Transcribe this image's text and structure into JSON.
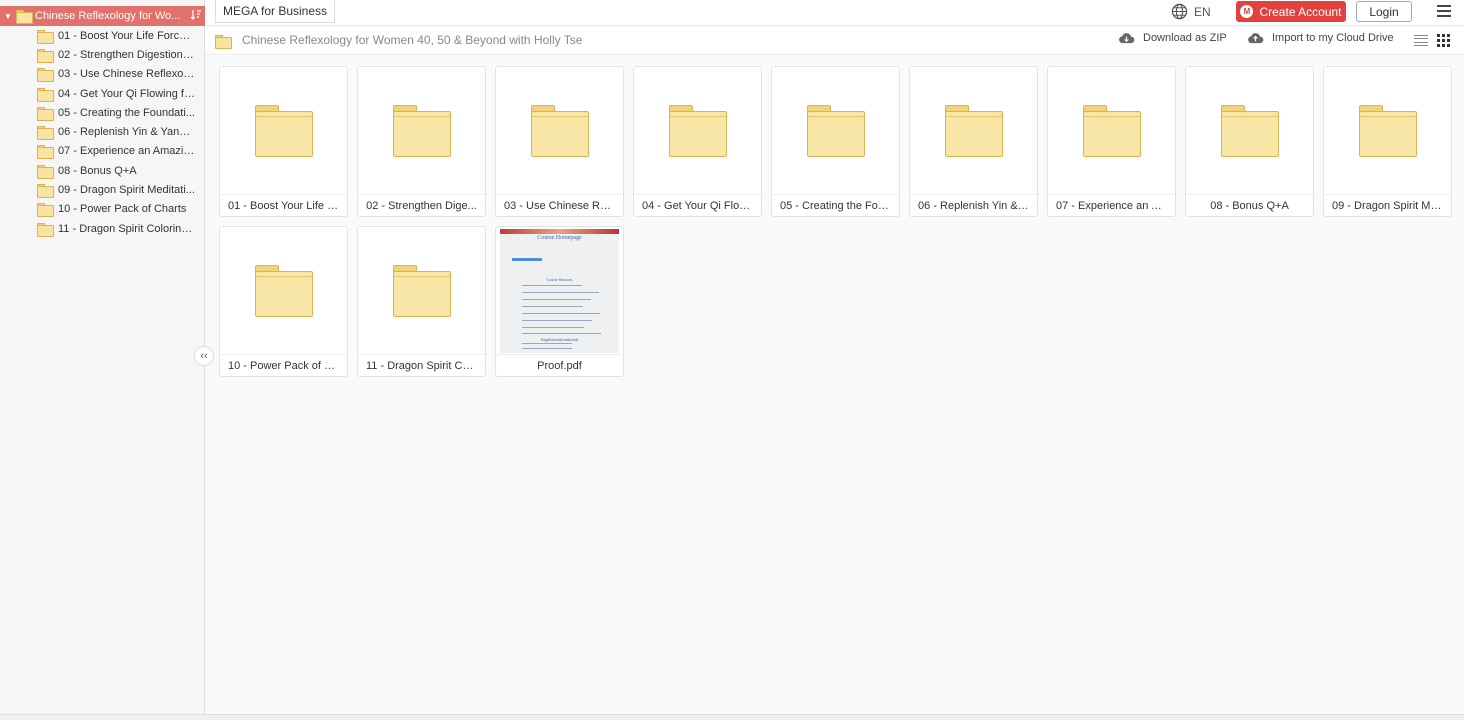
{
  "sidebar": {
    "root": {
      "label": "Chinese Reflexology for Wo...",
      "icon": "folder-icon"
    },
    "items": [
      {
        "label": "01 - Boost Your Life Force f..."
      },
      {
        "label": "02 - Strengthen Digestion f..."
      },
      {
        "label": "03 - Use Chinese Reflexolo..."
      },
      {
        "label": "04 - Get Your Qi Flowing fo..."
      },
      {
        "label": "05 - Creating the Foundati..."
      },
      {
        "label": "06 - Replenish Yin & Yang E..."
      },
      {
        "label": "07 - Experience an Amazin..."
      },
      {
        "label": "08 - Bonus Q+A"
      },
      {
        "label": "09 - Dragon Spirit Meditati..."
      },
      {
        "label": "10 - Power Pack of Charts"
      },
      {
        "label": "11 - Dragon Spirit Coloring..."
      }
    ],
    "collapse_glyph": "‹‹"
  },
  "topbar": {
    "business_tab": "MEGA for Business",
    "language": "EN",
    "create_account": "Create Account",
    "login": "Login",
    "brand_color": "#e0433e"
  },
  "pathbar": {
    "title": "Chinese Reflexology for Women 40, 50 & Beyond with Holly Tse",
    "download_zip": "Download as ZIP",
    "import": "Import to my Cloud Drive"
  },
  "grid": {
    "items": [
      {
        "name": "01 - Boost Your Life F...",
        "type": "folder"
      },
      {
        "name": "02 - Strengthen Dige...",
        "type": "folder"
      },
      {
        "name": "03 - Use Chinese Refl...",
        "type": "folder"
      },
      {
        "name": "04 - Get Your Qi Flow...",
        "type": "folder"
      },
      {
        "name": "05 - Creating the Fou...",
        "type": "folder"
      },
      {
        "name": "06 - Replenish Yin & Y...",
        "type": "folder"
      },
      {
        "name": "07 - Experience an A...",
        "type": "folder"
      },
      {
        "name": "08 - Bonus Q+A",
        "type": "folder"
      },
      {
        "name": "09 - Dragon Spirit Me...",
        "type": "folder"
      },
      {
        "name": "10 - Power Pack of C...",
        "type": "folder"
      },
      {
        "name": "11 - Dragon Spirit Col...",
        "type": "folder"
      },
      {
        "name": "Proof.pdf",
        "type": "pdf"
      }
    ],
    "pdf_preview": {
      "title": "Course Homepage",
      "section1": "Course Sessions",
      "section2": "Supplemental materials"
    }
  }
}
